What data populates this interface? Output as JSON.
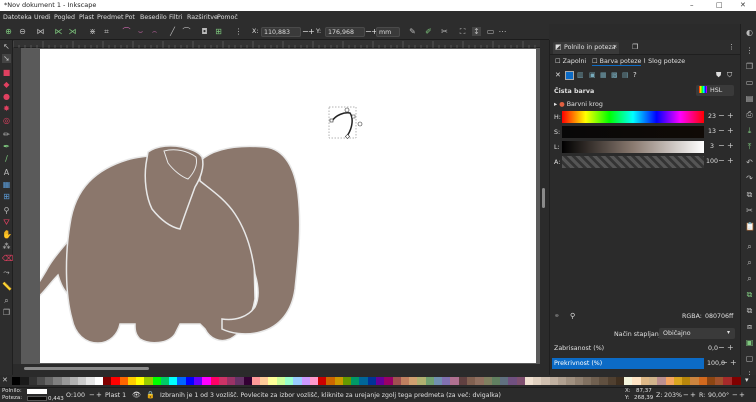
{
  "window": {
    "title": "*Nov dokument 1 - Inkscape",
    "minimize": "–",
    "maximize": "□",
    "close": "✕"
  },
  "menu": [
    "Datoteka",
    "Uredi",
    "Pogled",
    "Plast",
    "Predmet",
    "Pot",
    "Besedilo",
    "Filtri",
    "Razširitve",
    "Pomoč"
  ],
  "toolbar": {
    "x_label": "X:",
    "x_value": "110,883",
    "y_label": "Y:",
    "y_value": "176,968",
    "unit": "mm",
    "minus": "−",
    "plus": "+"
  },
  "panel": {
    "tabs": [
      {
        "label": "Polnilo in poteza",
        "close": "✕"
      }
    ],
    "subtabs": [
      "Zapolni",
      "Barva poteze",
      "Slog poteze"
    ],
    "section_title": "Čista barva",
    "color_mode": "HSL",
    "color_wheel_label": "Barvni krog",
    "sliders": [
      {
        "label": "H:",
        "value": "23"
      },
      {
        "label": "S:",
        "value": "13"
      },
      {
        "label": "L:",
        "value": "3"
      },
      {
        "label": "A:",
        "value": "100"
      }
    ],
    "rgba_label": "RGBA:",
    "rgba_value": "080706ff",
    "blend_label": "Način stapljanja:",
    "blend_value": "Običajno",
    "blur_label": "Zabrisanost (%)",
    "blur_value": "0,0",
    "opacity_label": "Prekrivnost (%)",
    "opacity_value": "100,0"
  },
  "status": {
    "fill_label": "Polnilo:",
    "stroke_label": "Poteza:",
    "stroke_width": "0,443",
    "opacity_label": "O:",
    "opacity_value": "100",
    "layer": "Plast 1",
    "message": "Izbranih je 1 od 3 vozlišč. Povlecite za izbor vozlišč, kliknite za urejanje zgolj tega predmeta (za več: dvigalka)",
    "x_label": "X:",
    "x_value": "87,37",
    "y_label": "Y:",
    "y_value": "268,39",
    "zoom_label": "Z:",
    "zoom_value": "203%",
    "rot_label": "R:",
    "rot_value": "90,00°"
  },
  "colors": {
    "elephant": "#8b776c",
    "accent": "#0c6bc6",
    "page": "#ffffff"
  },
  "palette": [
    "#000000",
    "#1a1a1a",
    "#333333",
    "#4d4d4d",
    "#666666",
    "#808080",
    "#999999",
    "#b3b3b3",
    "#cccccc",
    "#e6e6e6",
    "#ffffff",
    "#800000",
    "#ff0000",
    "#ff6600",
    "#ffcc00",
    "#ffff00",
    "#99cc00",
    "#00ff00",
    "#00cc66",
    "#00ffff",
    "#0066ff",
    "#0000ff",
    "#6600ff",
    "#ff00ff",
    "#ff0066",
    "#cc3366",
    "#993366",
    "#663366",
    "#330033",
    "#ff9999",
    "#ffcc99",
    "#ffff99",
    "#ccff99",
    "#99ffcc",
    "#99ccff",
    "#cc99ff",
    "#ff99cc",
    "#cc0000",
    "#cc6600",
    "#cc9900",
    "#669900",
    "#009966",
    "#006699",
    "#003399",
    "#660099",
    "#990066",
    "#a05050",
    "#c08060",
    "#d0a070",
    "#b0b070",
    "#70a070",
    "#7090b0",
    "#8070b0",
    "#b07090",
    "#604040",
    "#806050",
    "#907060",
    "#808060",
    "#608060",
    "#607080",
    "#705080",
    "#805070",
    "#f0e0d0",
    "#e0d0c0",
    "#d0c0b0",
    "#c0b0a0",
    "#b0a090",
    "#a09080",
    "#908070",
    "#807060",
    "#706050",
    "#605040",
    "#504030",
    "#403020",
    "#f5f5dc",
    "#ffe4c4",
    "#deb887",
    "#d2b48c",
    "#bc8f8f",
    "#f4a460",
    "#daa520",
    "#b8860b",
    "#cd853f",
    "#d2691e",
    "#8b4513",
    "#a0522d",
    "#a52a2a",
    "#800000"
  ]
}
